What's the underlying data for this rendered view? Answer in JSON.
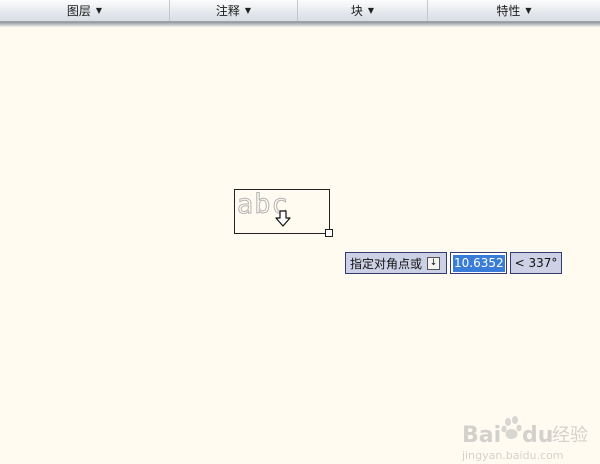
{
  "ribbon": {
    "panels": [
      {
        "label": "图层",
        "arrow": "▼",
        "width": 0
      },
      {
        "label": "注释",
        "arrow": "▼",
        "width": 0
      },
      {
        "label": "块",
        "arrow": "▼",
        "width": 0
      },
      {
        "label": "特性",
        "arrow": "▼",
        "width": 0
      }
    ]
  },
  "canvas": {
    "mtext_preview_text": "abc"
  },
  "dynamic_input": {
    "prompt": "指定对角点或",
    "options_icon": "↓",
    "length_value": "10.6352",
    "angle_value": "< 337°"
  },
  "watermark": {
    "brand": "Baidu",
    "brand_cn": "经验",
    "url": "jingyan.baidu.com"
  },
  "colors": {
    "canvas_background": "#fffbf0",
    "tooltip_fill": "#cdd1e6",
    "tooltip_border": "#343a73",
    "input_highlight": "#3a7dd8"
  }
}
